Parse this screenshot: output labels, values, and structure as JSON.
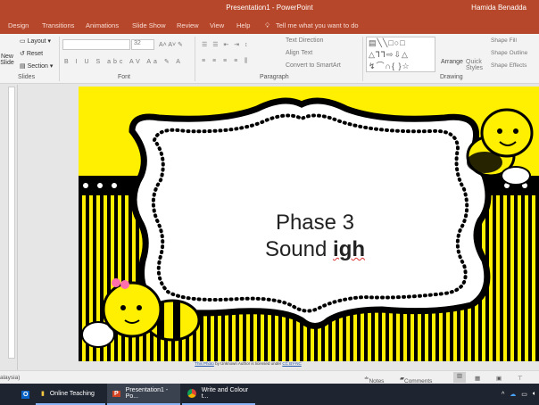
{
  "window": {
    "title": "Presentation1 - PowerPoint",
    "user": "Hamida Benadda"
  },
  "tabs": [
    "Design",
    "Transitions",
    "Animations",
    "Slide Show",
    "Review",
    "View",
    "Help"
  ],
  "tell_me": "Tell me what you want to do",
  "ribbon": {
    "slides": {
      "new_slide": "New Slide",
      "layout": "Layout",
      "reset": "Reset",
      "section": "Section",
      "label": "Slides"
    },
    "font": {
      "font_size": "32",
      "label": "Font"
    },
    "paragraph": {
      "text_direction": "Text Direction",
      "align_text": "Align Text",
      "convert_smartart": "Convert to SmartArt",
      "label": "Paragraph"
    },
    "drawing": {
      "arrange": "Arrange",
      "quick_styles": "Quick Styles",
      "shape_fill": "Shape Fill",
      "shape_outline": "Shape Outline",
      "shape_effects": "Shape Effects",
      "label": "Drawing"
    }
  },
  "slide": {
    "line1": "Phase 3",
    "line2_prefix": "Sound ",
    "line2_bold": "igh"
  },
  "caption": {
    "link1": "This Photo",
    "mid": " by Unknown Author is licensed under ",
    "link2": "CC BY-NC"
  },
  "status": {
    "language": "alaysia)",
    "notes": "Notes",
    "comments": "Comments"
  },
  "taskbar": [
    {
      "label": "Online Teaching"
    },
    {
      "label": "Presentation1 - Po..."
    },
    {
      "label": "Write and Colour t..."
    }
  ],
  "colors": {
    "accent": "#b7472a",
    "slide_bg": "#ffef00"
  }
}
